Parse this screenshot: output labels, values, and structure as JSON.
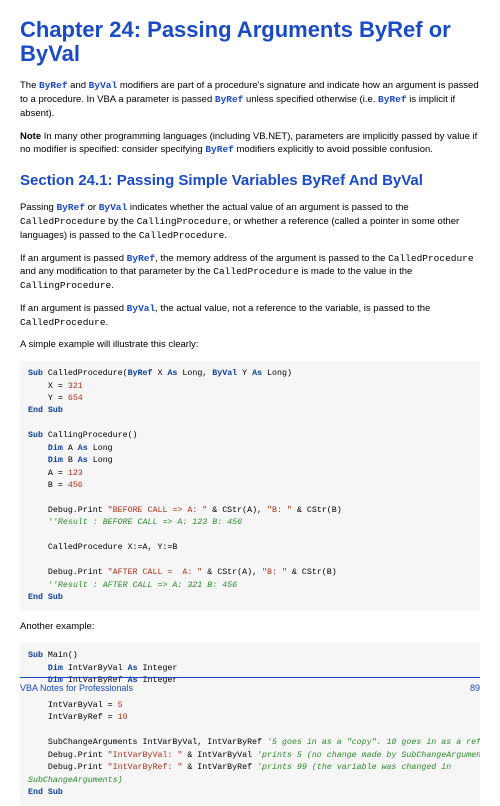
{
  "chapter": {
    "title": "Chapter 24: Passing Arguments ByRef or ByVal",
    "p1_a": "The ",
    "p1_byref": "ByRef",
    "p1_b": " and ",
    "p1_byval": "ByVal",
    "p1_c": " modifiers are part of a procedure's signature and indicate how an argument is passed to a procedure. In VBA a parameter is passed ",
    "p1_byref2": "ByRef",
    "p1_d": " unless specified otherwise (i.e. ",
    "p1_byref3": "ByRef",
    "p1_e": " is implicit if absent).",
    "note_label": "Note",
    "note_a": " In many other programming languages (including VB.NET), parameters are implicitly passed by value if no modifier is specified: consider specifying ",
    "note_byref": "ByRef",
    "note_b": " modifiers explicitly to avoid possible confusion."
  },
  "section": {
    "title": "Section 24.1: Passing Simple Variables ByRef And ByVal",
    "p1_a": "Passing ",
    "p1_byref": "ByRef",
    "p1_b": " or ",
    "p1_byval": "ByVal",
    "p1_c": " indicates whether the actual value of an argument is passed to the ",
    "p1_cp": "CalledProcedure",
    "p1_d": " by the ",
    "p1_cp2": "CallingProcedure",
    "p1_e": ", or whether a reference (called a pointer in some other languages) is passed to the ",
    "p1_cp3": "CalledProcedure",
    "p1_f": ".",
    "p2_a": "If an argument is passed ",
    "p2_byref": "ByRef",
    "p2_b": ", the memory address of the argument is passed to the ",
    "p2_cp": "CalledProcedure",
    "p2_c": " and any modification to that parameter by the ",
    "p2_cp2": "CalledProcedure",
    "p2_d": " is made to the value in the ",
    "p2_cp3": "CallingProcedure",
    "p2_e": ".",
    "p3_a": "If an argument is passed ",
    "p3_byval": "ByVal",
    "p3_b": ", the actual value, not a reference to the variable, is passed to the ",
    "p3_cp": "CalledProcedure",
    "p3_c": ".",
    "p4": "A simple example will illustrate this clearly:",
    "p5": "Another example:"
  },
  "footer": {
    "left": "VBA Notes for Professionals",
    "right": "89"
  }
}
